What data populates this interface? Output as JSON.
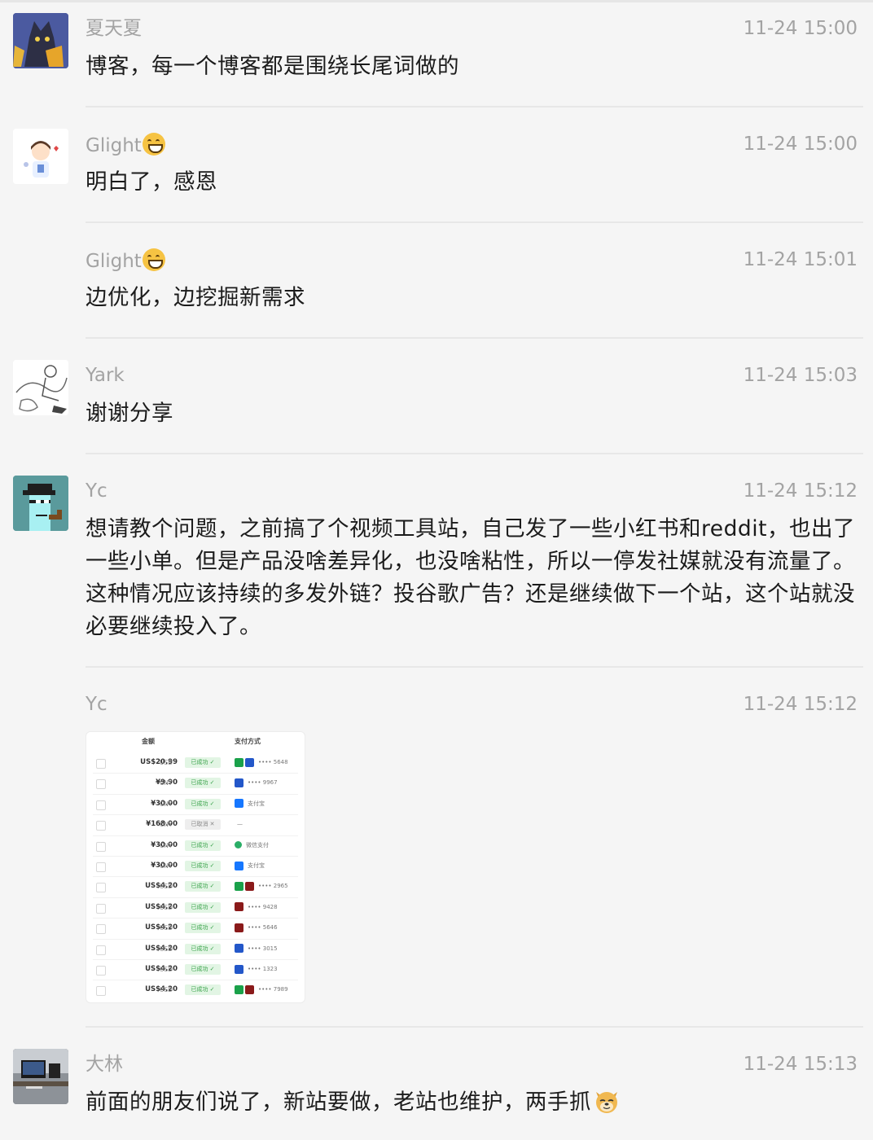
{
  "messages": [
    {
      "sender": "夏天夏",
      "sender_emoji": "",
      "time": "11-24 15:00",
      "text": "博客，每一个博客都是围绕长尾词做的",
      "avatar": "cat-avatar"
    },
    {
      "sender": "Glight",
      "sender_emoji": "grinning-face-emoji",
      "time": "11-24 15:00",
      "text": "明白了，感恩",
      "avatar": "doctor-avatar"
    },
    {
      "sender": "Glight",
      "sender_emoji": "grinning-face-emoji",
      "time": "11-24 15:01",
      "text": "边优化，边挖掘新需求",
      "avatar": ""
    },
    {
      "sender": "Yark",
      "sender_emoji": "",
      "time": "11-24 15:03",
      "text": "谢谢分享",
      "avatar": "sketch-avatar"
    },
    {
      "sender": "Yc",
      "sender_emoji": "",
      "time": "11-24 15:12",
      "text": "想请教个问题，之前搞了个视频工具站，自己发了一些小红书和reddit，也出了一些小单。但是产品没啥差异化，也没啥粘性，所以一停发社媒就没有流量了。这种情况应该持续的多发外链？投谷歌广告？还是继续做下一个站，这个站就没必要继续投入了。",
      "avatar": "pixel-punk-avatar"
    },
    {
      "sender": "Yc",
      "sender_emoji": "",
      "time": "11-24 15:12",
      "text": "",
      "avatar": "",
      "image": "payments-screenshot"
    },
    {
      "sender": "大林",
      "sender_emoji": "",
      "time": "11-24 15:13",
      "text": "前面的朋友们说了，新站要做，老站也维护，两手抓",
      "text_emoji": "doge-emoji",
      "avatar": "desk-photo-avatar"
    }
  ],
  "thumbnail": {
    "headers": [
      "金额",
      "支付方式"
    ],
    "rows": [
      {
        "amount": "US$20.99",
        "currency": "USD",
        "status": "已成功 ✓",
        "status_ok": true,
        "methods": [
          "green",
          "blue"
        ],
        "card": "•••• 5648"
      },
      {
        "amount": "¥9.90",
        "currency": "CNY",
        "status": "已成功 ✓",
        "status_ok": true,
        "methods": [
          "blue"
        ],
        "card": "•••• 9967"
      },
      {
        "amount": "¥30.00",
        "currency": "CNY",
        "status": "已成功 ✓",
        "status_ok": true,
        "methods": [
          "alipay"
        ],
        "card": "支付宝"
      },
      {
        "amount": "¥168.00",
        "currency": "CNY",
        "status": "已取消 ✕",
        "status_ok": false,
        "methods": [],
        "card": "—"
      },
      {
        "amount": "¥30.00",
        "currency": "CNY",
        "status": "已成功 ✓",
        "status_ok": true,
        "methods": [
          "wechat"
        ],
        "card": "微信支付"
      },
      {
        "amount": "¥30.00",
        "currency": "CNY",
        "status": "已成功 ✓",
        "status_ok": true,
        "methods": [
          "alipay"
        ],
        "card": "支付宝"
      },
      {
        "amount": "US$4.20",
        "currency": "USD",
        "status": "已成功 ✓",
        "status_ok": true,
        "methods": [
          "green",
          "dark"
        ],
        "card": "•••• 2965"
      },
      {
        "amount": "US$4.20",
        "currency": "USD",
        "status": "已成功 ✓",
        "status_ok": true,
        "methods": [
          "dark"
        ],
        "card": "•••• 9428"
      },
      {
        "amount": "US$4.20",
        "currency": "USD",
        "status": "已成功 ✓",
        "status_ok": true,
        "methods": [
          "dark"
        ],
        "card": "•••• 5646"
      },
      {
        "amount": "US$4.20",
        "currency": "USD",
        "status": "已成功 ✓",
        "status_ok": true,
        "methods": [
          "blue"
        ],
        "card": "•••• 3015"
      },
      {
        "amount": "US$4.20",
        "currency": "USD",
        "status": "已成功 ✓",
        "status_ok": true,
        "methods": [
          "blue"
        ],
        "card": "•••• 1323"
      },
      {
        "amount": "US$4.20",
        "currency": "USD",
        "status": "已成功 ✓",
        "status_ok": true,
        "methods": [
          "green",
          "dark"
        ],
        "card": "•••• 7989"
      }
    ]
  },
  "colors": {
    "green": "#1aa14a",
    "blue": "#2357c9",
    "dark": "#8a1a1a",
    "alipay": "#1677ff",
    "wechat": "#2aae67"
  }
}
